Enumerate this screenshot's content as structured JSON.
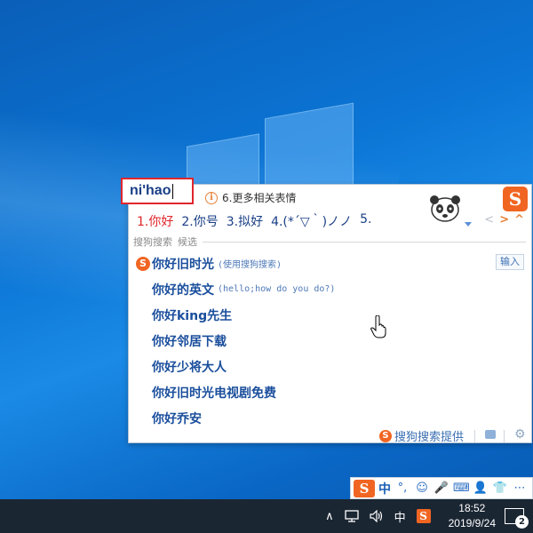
{
  "ime": {
    "composition": "ni'hao",
    "hint": "6.更多相关表情",
    "candidates": [
      "1.你好",
      "2.你号",
      "3.拟好",
      "4.(*´▽｀)ノノ",
      "5."
    ],
    "section_title": "搜狗搜索",
    "section_sub": "候选",
    "suggestions": [
      {
        "text": "你好旧时光",
        "note": "(使用搜狗搜索)"
      },
      {
        "text": "你好的英文",
        "note": "(hello;how do you do?)"
      },
      {
        "text": "你好king先生",
        "note": ""
      },
      {
        "text": "你好邻居下载",
        "note": ""
      },
      {
        "text": "你好少将大人",
        "note": ""
      },
      {
        "text": "你好旧时光电视剧免费",
        "note": ""
      },
      {
        "text": "你好乔安",
        "note": ""
      }
    ],
    "input_button": "输入",
    "provider": "搜狗搜索提供",
    "logo_letter": "S"
  },
  "toolbar": {
    "logo": "S",
    "mode": "中",
    "punct": "°,",
    "items": [
      "☺",
      "🎤",
      "⌨",
      "👤",
      "👕",
      "⋯"
    ]
  },
  "taskbar": {
    "chevron": "∧",
    "lang": "中",
    "sogou": "S",
    "time": "18:52",
    "date": "2019/9/24",
    "notifications": "2"
  },
  "colors": {
    "sogou_orange": "#f16522",
    "candidate_red": "#e0262c",
    "link_blue": "#1a4e9c",
    "taskbar": "#1b2633"
  }
}
